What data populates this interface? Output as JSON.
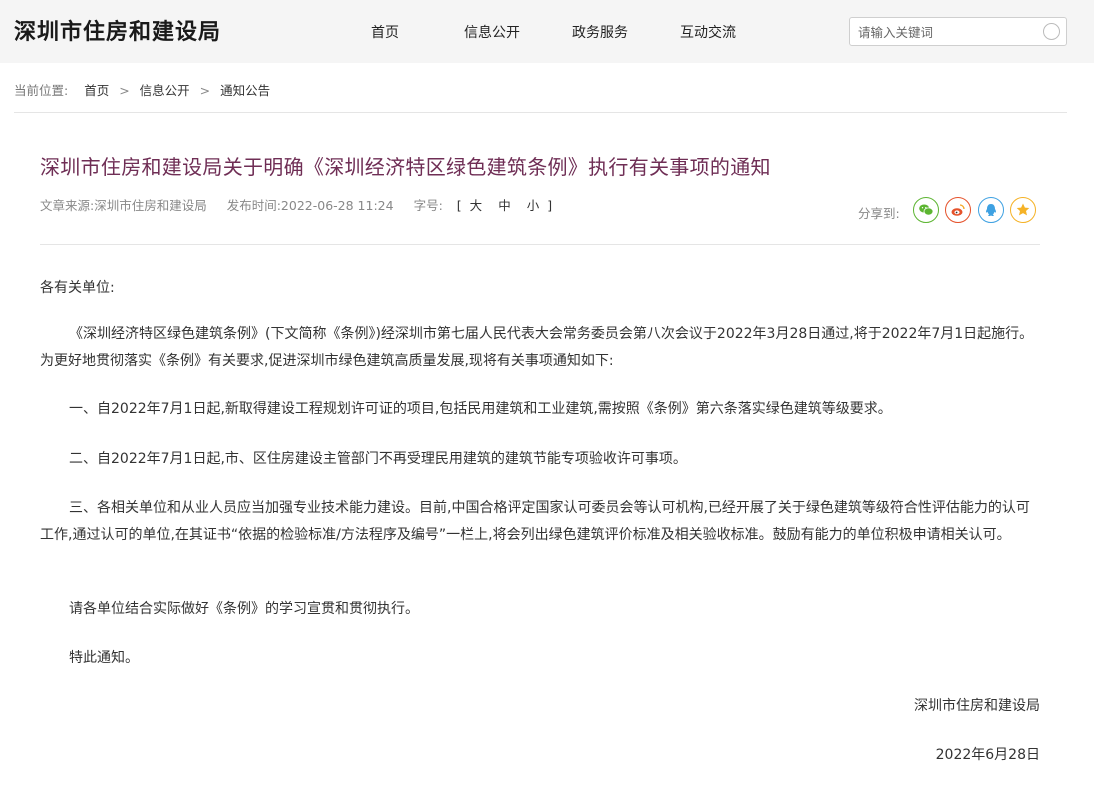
{
  "header": {
    "site_title": "深圳市住房和建设局",
    "nav": [
      "首页",
      "信息公开",
      "政务服务",
      "互动交流"
    ],
    "search_placeholder": "请输入关键词"
  },
  "breadcrumb": {
    "prefix": "当前位置:",
    "items": [
      "首页",
      "信息公开",
      "通知公告"
    ],
    "separator": ">"
  },
  "article": {
    "title": "深圳市住房和建设局关于明确《深圳经济特区绿色建筑条例》执行有关事项的通知",
    "meta": {
      "source": "文章来源:深圳市住房和建设局",
      "published": "发布时间:2022-06-28 11:24",
      "font_size_label": "字号:",
      "font_size_open": "[",
      "font_size_large": "大",
      "font_size_medium": "中",
      "font_size_small": "小",
      "font_size_close": "]"
    },
    "share": {
      "label": "分享到:",
      "buttons": [
        {
          "name": "wechat",
          "icon": "wechat-icon",
          "color": "#5cb531"
        },
        {
          "name": "weibo",
          "icon": "weibo-icon",
          "color": "#e5522b"
        },
        {
          "name": "qq",
          "icon": "qq-icon",
          "color": "#3ea1e2"
        },
        {
          "name": "qzone",
          "icon": "star-icon",
          "color": "#f5b226"
        }
      ]
    },
    "body": {
      "salutation": "各有关单位:",
      "p1": "《深圳经济特区绿色建筑条例》(下文简称《条例》)经深圳市第七届人民代表大会常务委员会第八次会议于2022年3月28日通过,将于2022年7月1日起施行。为更好地贯彻落实《条例》有关要求,促进深圳市绿色建筑高质量发展,现将有关事项通知如下:",
      "p2": "一、自2022年7月1日起,新取得建设工程规划许可证的项目,包括民用建筑和工业建筑,需按照《条例》第六条落实绿色建筑等级要求。",
      "p3": "二、自2022年7月1日起,市、区住房建设主管部门不再受理民用建筑的建筑节能专项验收许可事项。",
      "p4": "三、各相关单位和从业人员应当加强专业技术能力建设。目前,中国合格评定国家认可委员会等认可机构,已经开展了关于绿色建筑等级符合性评估能力的认可工作,通过认可的单位,在其证书“依据的检验标准/方法程序及编号”一栏上,将会列出绿色建筑评价标准及相关验收标准。鼓励有能力的单位积极申请相关认可。",
      "p5": "请各单位结合实际做好《条例》的学习宣贯和贯彻执行。",
      "p6": "特此通知。",
      "signature": "深圳市住房和建设局",
      "date": "2022年6月28日"
    }
  },
  "colors": {
    "title": "#6f2e55",
    "header_bg": "#f5f5f5"
  }
}
